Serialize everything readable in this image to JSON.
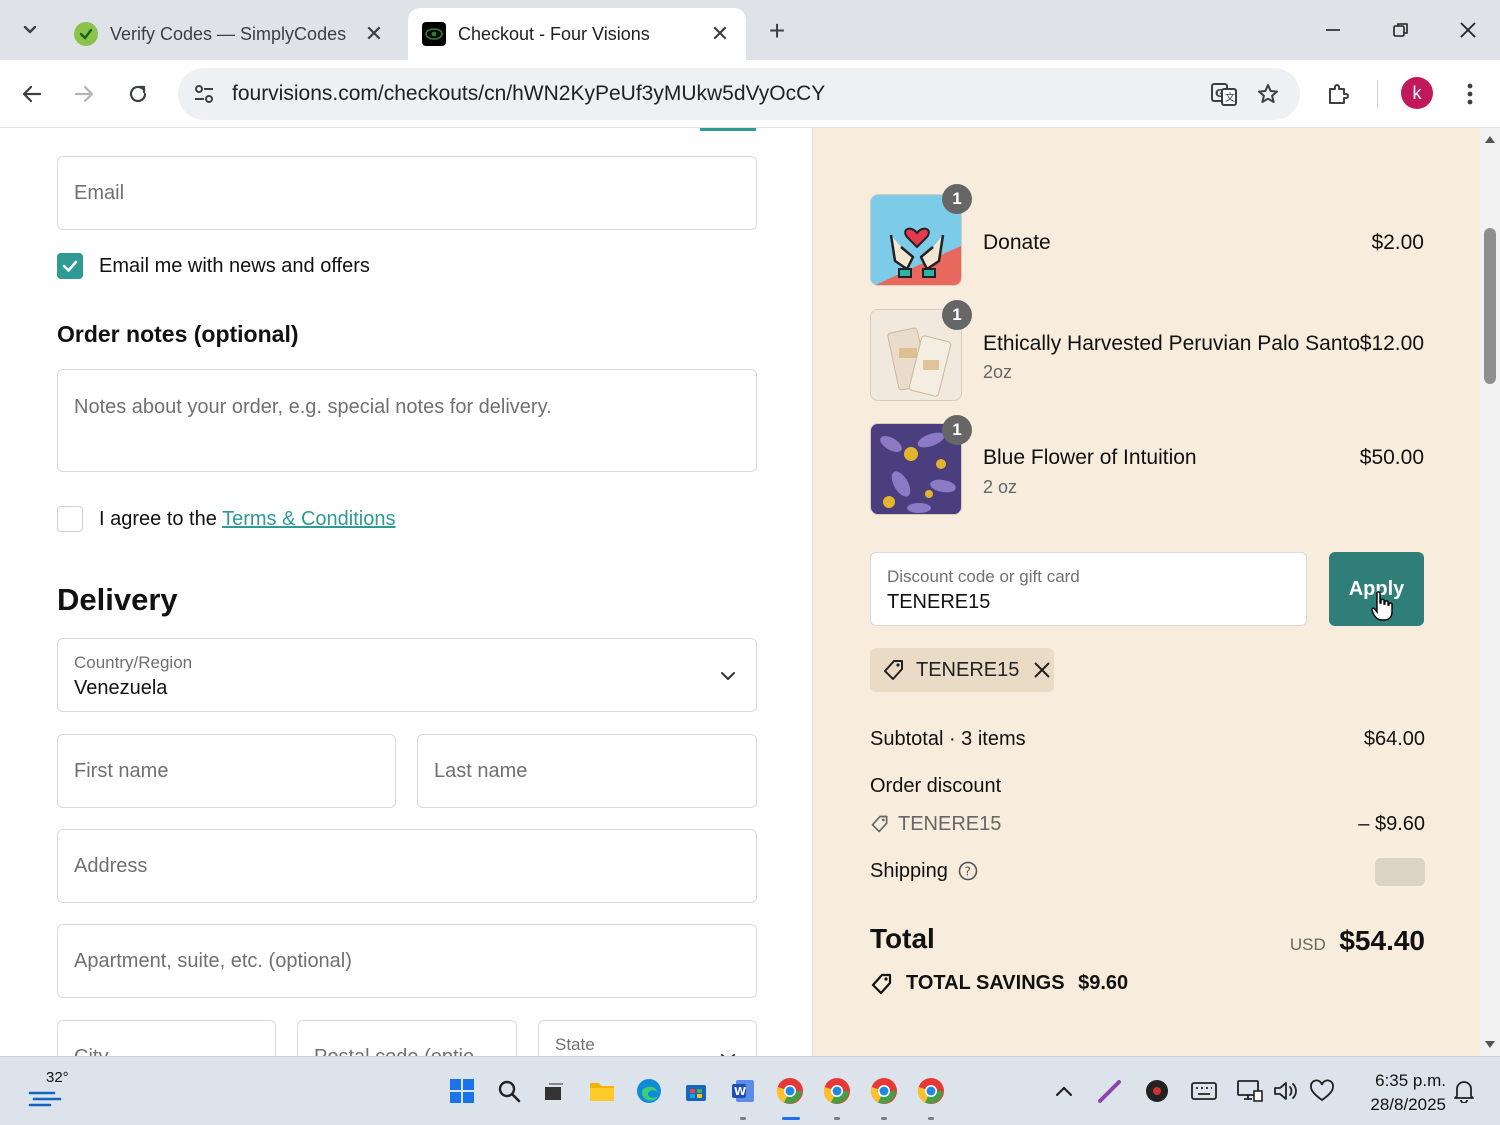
{
  "browser": {
    "tabs": [
      {
        "title": "Verify Codes — SimplyCodes",
        "active": false
      },
      {
        "title": "Checkout - Four Visions",
        "active": true
      }
    ],
    "url": "fourvisions.com/checkouts/cn/hWN2KyPeUf3yMUkw5dVyOcCY",
    "profile_initial": "k"
  },
  "contact": {
    "email_placeholder": "Email",
    "news_checkbox_label": "Email me with news and offers",
    "news_checked": true
  },
  "order_notes": {
    "heading": "Order notes (optional)",
    "placeholder": "Notes about your order, e.g. special notes for delivery."
  },
  "terms": {
    "prefix": "I agree to the",
    "link": "Terms & Conditions",
    "checked": false
  },
  "delivery": {
    "heading": "Delivery",
    "country_label": "Country/Region",
    "country_value": "Venezuela",
    "first_name_placeholder": "First name",
    "last_name_placeholder": "Last name",
    "address_placeholder": "Address",
    "apartment_placeholder": "Apartment, suite, etc. (optional)",
    "city_placeholder": "City",
    "postal_placeholder": "Postal code (optio",
    "state_label": "State"
  },
  "cart": {
    "items": [
      {
        "name": "Donate",
        "variant": "",
        "price": "$2.00",
        "qty": "1"
      },
      {
        "name": "Ethically Harvested Peruvian Palo Santo",
        "variant": "2oz",
        "price": "$12.00",
        "qty": "1"
      },
      {
        "name": "Blue Flower of Intuition",
        "variant": "2 oz",
        "price": "$50.00",
        "qty": "1"
      }
    ],
    "discount_label": "Discount code or gift card",
    "discount_value": "TENERE15",
    "apply_label": "Apply",
    "applied_code": "TENERE15"
  },
  "summary": {
    "subtotal_label": "Subtotal · 3 items",
    "subtotal_value": "$64.00",
    "order_discount_label": "Order discount",
    "discount_code": "TENERE15",
    "discount_value": "– $9.60",
    "shipping_label": "Shipping",
    "total_label": "Total",
    "currency": "USD",
    "total_value": "$54.40",
    "savings_label": "TOTAL SAVINGS",
    "savings_value": "$9.60"
  },
  "taskbar": {
    "weather_temp": "32°",
    "time": "6:35 p.m.",
    "date": "28/8/2025"
  },
  "colors": {
    "accent": "#2f9a93",
    "apply_button": "#2f7e78",
    "summary_bg": "#f8ecdc",
    "link": "#2f9a93"
  }
}
